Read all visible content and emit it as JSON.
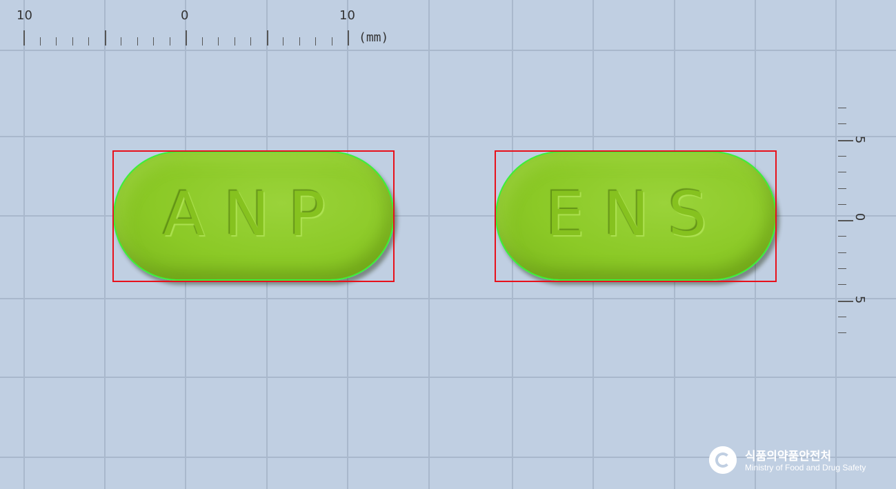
{
  "ruler_top": {
    "labels": [
      "10",
      "0",
      "10"
    ],
    "unit": "(mm)"
  },
  "ruler_right": {
    "labels": [
      "5",
      "0",
      "5"
    ]
  },
  "pills": [
    {
      "imprint": "ANP",
      "color": "#8bc926"
    },
    {
      "imprint": "ENS",
      "color": "#8bc926"
    }
  ],
  "colors": {
    "background": "#c0cfe2",
    "grid": "#a9b8cc",
    "bounding_box": "#e8101a",
    "contour": "#3bf03b"
  },
  "logo": {
    "korean": "식품의약품안전처",
    "english": "Ministry of Food and Drug Safety",
    "icon": "mfds-emblem-icon"
  }
}
